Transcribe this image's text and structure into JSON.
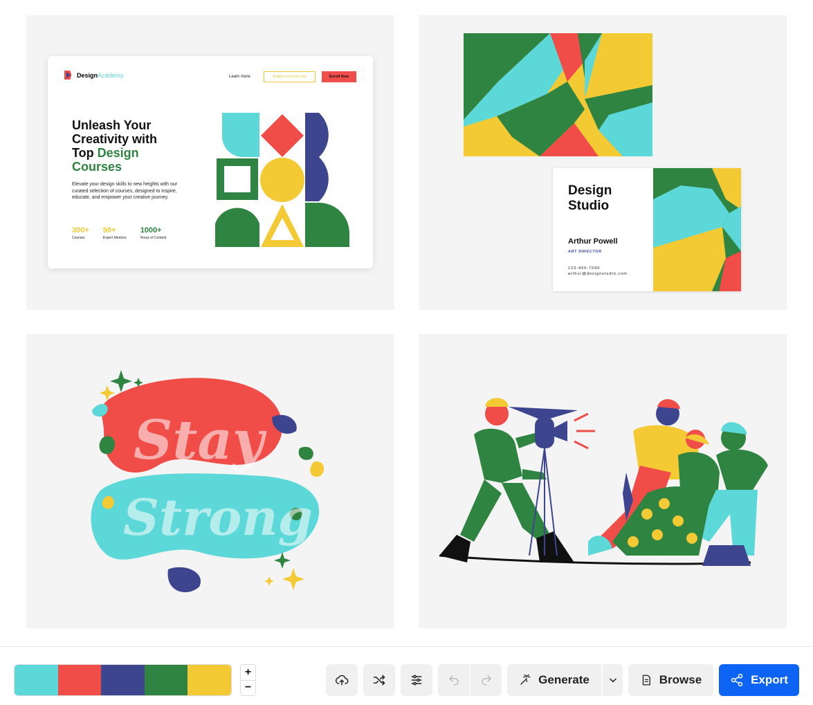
{
  "landing": {
    "brand_prefix": "Design",
    "brand_accent": "Academy",
    "learn_more": "Learn more",
    "explore": "Explore Course List",
    "enroll": "Enroll Now",
    "heading_line1": "Unleash Your",
    "heading_line2": "Creativity with",
    "heading_line3_a": "Top ",
    "heading_line3_b": "Design",
    "heading_line4": "Courses",
    "description": "Elevate your design skills to new heights with our curated selection of courses, designed to inspire, educate, and empower your creative journey.",
    "stats": [
      {
        "value": "300+",
        "label": "Courses"
      },
      {
        "value": "50+",
        "label": "Expert Mentors"
      },
      {
        "value": "1000+",
        "label": "Hours of Content"
      }
    ]
  },
  "business_card": {
    "title": "Design Studio",
    "name": "Arthur Powell",
    "role": "ART DIRECTOR",
    "phone": "123-456-7590",
    "email": "arthur@designstudio.com"
  },
  "palette": {
    "colors": [
      "#5cd8d8",
      "#f04c48",
      "#3c458e",
      "#2e8440",
      "#f3c934"
    ]
  },
  "toolbar": {
    "zoom_in": "+",
    "zoom_out": "−",
    "generate": "Generate",
    "browse": "Browse",
    "export": "Export",
    "export_color": "#0d63f3"
  },
  "icons": [
    "upload-cloud-icon",
    "shuffle-icon",
    "sliders-icon",
    "undo-icon",
    "redo-icon",
    "magic-wand-icon",
    "chevron-down-icon",
    "document-icon",
    "share-icon"
  ]
}
